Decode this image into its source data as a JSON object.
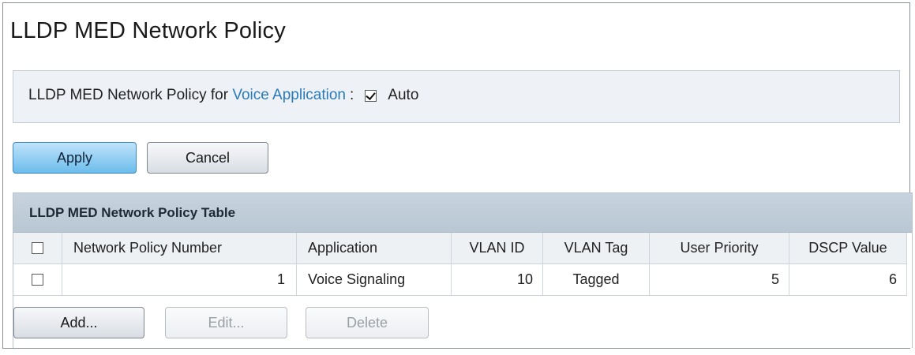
{
  "page": {
    "title": "LLDP MED Network Policy"
  },
  "settings": {
    "label_prefix": "LLDP MED Network Policy for ",
    "label_link": "Voice Application",
    "label_suffix": ":",
    "auto_checked": true,
    "auto_label": "Auto"
  },
  "actions": {
    "apply_label": "Apply",
    "cancel_label": "Cancel"
  },
  "table": {
    "title": "LLDP MED Network Policy Table",
    "columns": [
      "Network Policy Number",
      "Application",
      "VLAN ID",
      "VLAN Tag",
      "User Priority",
      "DSCP Value"
    ],
    "rows": [
      {
        "selected": false,
        "network_policy_number": "1",
        "application": "Voice Signaling",
        "vlan_id": "10",
        "vlan_tag": "Tagged",
        "user_priority": "5",
        "dscp_value": "6"
      }
    ],
    "buttons": {
      "add_label": "Add...",
      "edit_label": "Edit...",
      "delete_label": "Delete"
    }
  },
  "colors": {
    "link": "#2a7ab8",
    "primary_button": "#6cbdec",
    "table_header": "#bccad7"
  }
}
